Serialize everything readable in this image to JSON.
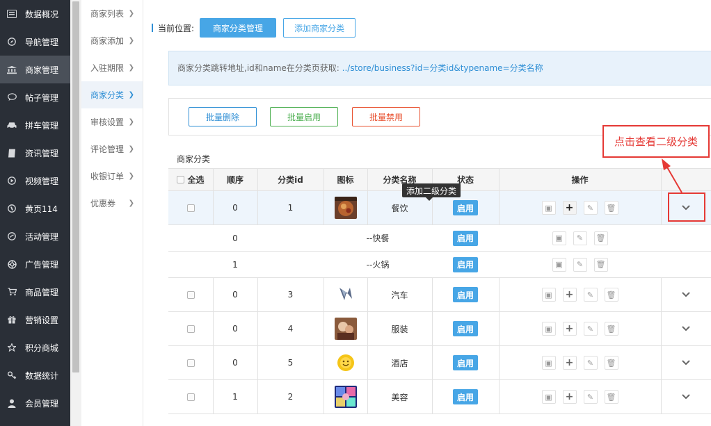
{
  "sidebar": {
    "items": [
      {
        "label": "数据概况",
        "icon": "dashboard-icon"
      },
      {
        "label": "导航管理",
        "icon": "compass-icon"
      },
      {
        "label": "商家管理",
        "icon": "bank-icon"
      },
      {
        "label": "帖子管理",
        "icon": "chat-icon"
      },
      {
        "label": "拼车管理",
        "icon": "car-icon"
      },
      {
        "label": "资讯管理",
        "icon": "book-icon"
      },
      {
        "label": "视频管理",
        "icon": "video-icon"
      },
      {
        "label": "黄页114",
        "icon": "phone-icon"
      },
      {
        "label": "活动管理",
        "icon": "activity-icon"
      },
      {
        "label": "广告管理",
        "icon": "lifebuoy-icon"
      },
      {
        "label": "商品管理",
        "icon": "cart-icon"
      },
      {
        "label": "营销设置",
        "icon": "gift-icon"
      },
      {
        "label": "积分商城",
        "icon": "star-icon"
      },
      {
        "label": "数据统计",
        "icon": "key-icon"
      },
      {
        "label": "会员管理",
        "icon": "user-icon"
      }
    ],
    "active": "商家管理"
  },
  "submenu": {
    "items": [
      "商家列表",
      "商家添加",
      "入驻期限",
      "商家分类",
      "审核设置",
      "评论管理",
      "收银订单",
      "优惠券"
    ],
    "active": "商家分类"
  },
  "breadcrumb": {
    "label": "当前位置:",
    "current": "商家分类管理",
    "add_button": "添加商家分类"
  },
  "info": {
    "text": "商家分类跳转地址,id和name在分类页获取:",
    "link": "../store/business?id=分类id&typename=分类名称"
  },
  "actions": {
    "batch_delete": "批量删除",
    "batch_enable": "批量启用",
    "batch_disable": "批量禁用"
  },
  "section_title": "商家分类",
  "table": {
    "headers": {
      "select_all": "全选",
      "order": "顺序",
      "id": "分类id",
      "icon": "图标",
      "name": "分类名称",
      "status": "状态",
      "ops": "操作"
    },
    "rows": [
      {
        "type": "main",
        "order": "0",
        "id": "1",
        "name": "餐饮",
        "status": "启用",
        "icon": "food-thumbnail",
        "highlight": true
      },
      {
        "type": "sub",
        "order": "0",
        "name": "--快餐",
        "status": "启用"
      },
      {
        "type": "sub",
        "order": "1",
        "name": "--火锅",
        "status": "启用"
      },
      {
        "type": "main",
        "order": "0",
        "id": "3",
        "name": "汽车",
        "status": "启用",
        "icon": "car-thumbnail"
      },
      {
        "type": "main",
        "order": "0",
        "id": "4",
        "name": "服装",
        "status": "启用",
        "icon": "clothing-thumbnail"
      },
      {
        "type": "main",
        "order": "0",
        "id": "5",
        "name": "酒店",
        "status": "启用",
        "icon": "hotel-thumbnail"
      },
      {
        "type": "main",
        "order": "1",
        "id": "2",
        "name": "美容",
        "status": "启用",
        "icon": "beauty-thumbnail"
      }
    ]
  },
  "tooltip": "添加二级分类",
  "callout": "点击查看二级分类",
  "colors": {
    "sidebar_bg": "#2a2f37",
    "accent": "#47a6e6",
    "success": "#4caf50",
    "danger": "#e8502f",
    "annotation_red": "#e53935"
  }
}
